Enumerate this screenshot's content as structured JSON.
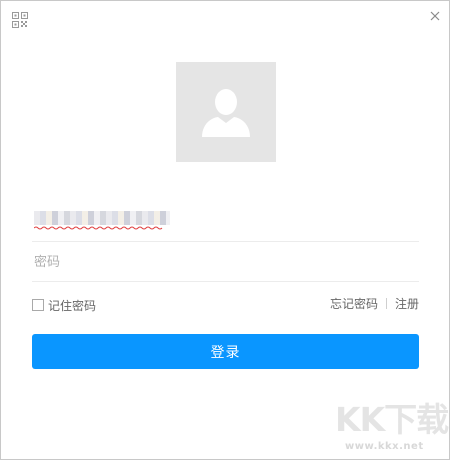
{
  "window": {
    "close_icon": "close-icon",
    "qr_icon": "qr-code-icon"
  },
  "avatar": {
    "icon": "user-icon"
  },
  "form": {
    "password_placeholder": "密码",
    "remember_label": "记住密码",
    "forgot_label": "忘记密码",
    "register_label": "注册",
    "login_label": "登录"
  },
  "watermark": {
    "logo_text": "KK下载",
    "url": "www.kkx.net"
  },
  "colors": {
    "accent": "#0a96ff",
    "avatar_bg": "#e5e5e5"
  }
}
